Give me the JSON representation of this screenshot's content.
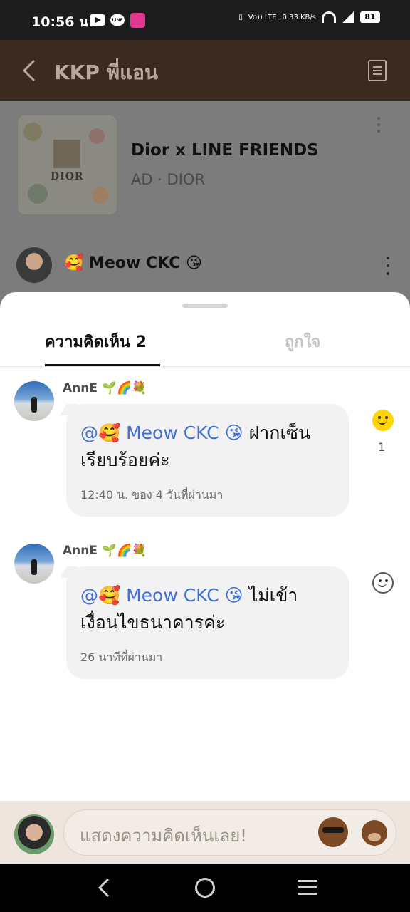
{
  "status_bar": {
    "time": "10:56 น.",
    "volte": "Vo)) LTE",
    "net_speed": "0.33 KB/s",
    "battery": "81"
  },
  "header": {
    "title": "KKP พี่แอน"
  },
  "ad": {
    "title": "Dior x LINE FRIENDS",
    "subtitle": "AD · DIOR",
    "thumb_brand": "DIOR"
  },
  "post": {
    "author": "🥰 Meow CKC 😘"
  },
  "tabs": {
    "comments": "ความคิดเห็น 2",
    "likes": "ถูกใจ"
  },
  "comments": [
    {
      "author": "AnnE 🌱🌈💐",
      "mention": "@🥰 Meow CKC 😘",
      "text": " ฝากเซ็นเรียบร้อยค่ะ",
      "time": "12:40 น. ของ 4 วันที่ผ่านมา",
      "reaction_count": "1",
      "reacted": true
    },
    {
      "author": "AnnE 🌱🌈💐",
      "mention": "@🥰 Meow CKC 😘",
      "text": " ไม่เข้าเงื่อนไขธนาคารค่ะ",
      "time": "26 นาทีที่ผ่านมา",
      "reaction_count": "",
      "reacted": false
    }
  ],
  "input": {
    "placeholder": "แสดงความคิดเห็นเลย!"
  },
  "colors": {
    "header_bg": "#3b2a20",
    "mention": "#3f6fd8",
    "reaction_active": "#ffd400",
    "input_bar_bg": "#eee6dd"
  },
  "icons": [
    "back-arrow-icon",
    "menu-doc-icon",
    "more-vert-icon",
    "smiley-react-icon",
    "sticker-brown-icon",
    "nav-back-icon",
    "nav-home-icon",
    "nav-recent-icon"
  ]
}
